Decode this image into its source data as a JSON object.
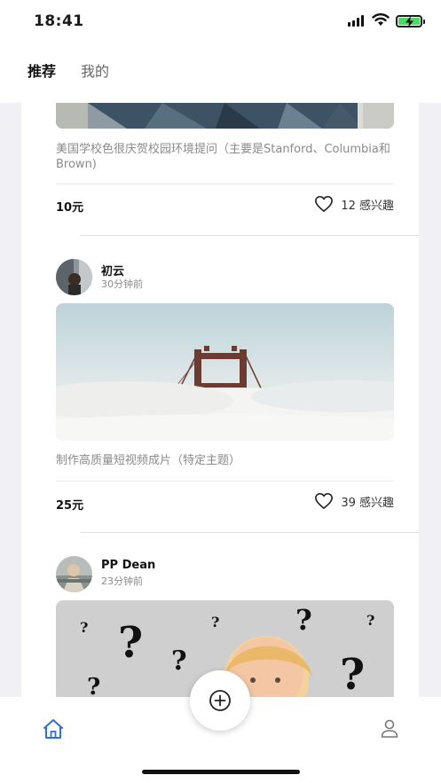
{
  "status_bar": {
    "time": "18:41"
  },
  "tabs": [
    {
      "label": "推荐",
      "active": true
    },
    {
      "label": "我的",
      "active": false
    }
  ],
  "posts": [
    {
      "description": "美国学校色很庆贺校园环境提问（主要是Stanford、Columbia和Brown)",
      "price": "10元",
      "interest": "12 感兴趣"
    },
    {
      "username": "初云",
      "time": "30分钟前",
      "description": "制作高质量短视频成片（特定主题）",
      "price": "25元",
      "interest": "39 感兴趣"
    },
    {
      "username": "PP Dean",
      "time": "23分钟前"
    }
  ],
  "colors": {
    "accent": "#2f6fd6",
    "battery": "#4cd964",
    "price_text": "#111111",
    "muted_text": "#8a8a8a"
  },
  "icons": {
    "home": "home-icon",
    "profile": "person-icon",
    "add": "plus-circle-icon",
    "heart": "heart-outline-icon"
  }
}
